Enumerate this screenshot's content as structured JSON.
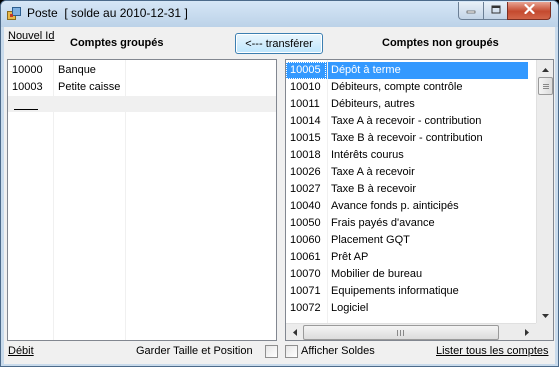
{
  "window": {
    "title": "Poste  [ solde au 2010-12-31 ]"
  },
  "toolbar": {
    "new_id_link": "Nouvel Id",
    "transfer_button": "<--- transférer"
  },
  "left_panel": {
    "header": "Comptes groupés",
    "rows": [
      {
        "code": "10000",
        "name": "Banque"
      },
      {
        "code": "10003",
        "name": "Petite caisse"
      }
    ]
  },
  "right_panel": {
    "header": "Comptes non groupés",
    "selected_code": "10005",
    "rows": [
      {
        "code": "10005",
        "name": "Dépôt à terme"
      },
      {
        "code": "10010",
        "name": "Débiteurs, compte contrôle"
      },
      {
        "code": "10011",
        "name": "Débiteurs, autres"
      },
      {
        "code": "10014",
        "name": "Taxe A à recevoir - contribution"
      },
      {
        "code": "10015",
        "name": "Taxe B à recevoir - contribution"
      },
      {
        "code": "10018",
        "name": "Intérêts courus"
      },
      {
        "code": "10026",
        "name": "Taxe A à recevoir"
      },
      {
        "code": "10027",
        "name": "Taxe B à recevoir"
      },
      {
        "code": "10040",
        "name": "Avance fonds p. aintici­pés"
      },
      {
        "code": "10050",
        "name": "Frais payés d'avance"
      },
      {
        "code": "10060",
        "name": "Placement GQT"
      },
      {
        "code": "10061",
        "name": "Prêt AP"
      },
      {
        "code": "10070",
        "name": "Mobilier de bureau"
      },
      {
        "code": "10071",
        "name": "Equipements informatique"
      },
      {
        "code": "10072",
        "name": "Logiciel"
      }
    ]
  },
  "footer": {
    "debit_link": "Débit",
    "keep_size_label": "Garder Taille et Position",
    "keep_size_checked": false,
    "show_balance_label": "Afficher Soldes",
    "show_balance_checked": false,
    "list_all_link": "Lister tous les comptes"
  },
  "colors": {
    "selection": "#3399ff",
    "close_button": "#c44a2f"
  },
  "icons": {
    "app": "app-icon",
    "minimize": "minimize-icon",
    "maximize": "maximize-icon",
    "close": "close-icon"
  }
}
